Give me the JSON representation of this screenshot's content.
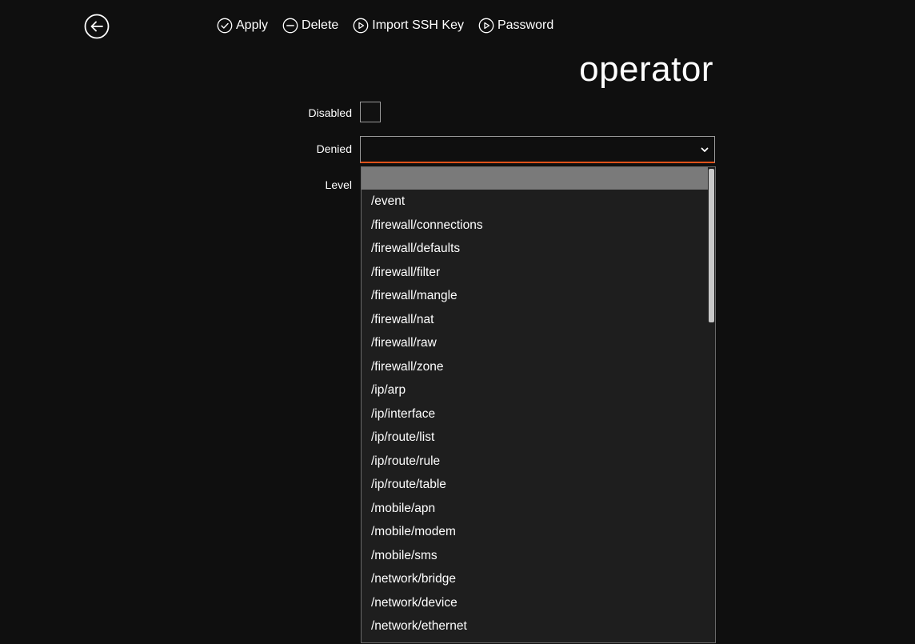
{
  "toolbar": {
    "apply_label": "Apply",
    "delete_label": "Delete",
    "import_ssh_label": "Import SSH Key",
    "password_label": "Password"
  },
  "page": {
    "title": "operator"
  },
  "form": {
    "disabled_label": "Disabled",
    "disabled_checked": false,
    "denied_label": "Denied",
    "denied_value": "",
    "level_label": "Level"
  },
  "dropdown": {
    "options": [
      "",
      "/event",
      "/firewall/connections",
      "/firewall/defaults",
      "/firewall/filter",
      "/firewall/mangle",
      "/firewall/nat",
      "/firewall/raw",
      "/firewall/zone",
      "/ip/arp",
      "/ip/interface",
      "/ip/route/list",
      "/ip/route/rule",
      "/ip/route/table",
      "/mobile/apn",
      "/mobile/modem",
      "/mobile/sms",
      "/network/bridge",
      "/network/device",
      "/network/ethernet"
    ]
  },
  "colors": {
    "background": "#0f0f0f",
    "accent": "#e0521a",
    "dropdown_bg": "#1e1e1e",
    "highlight": "#7a7a7a"
  }
}
